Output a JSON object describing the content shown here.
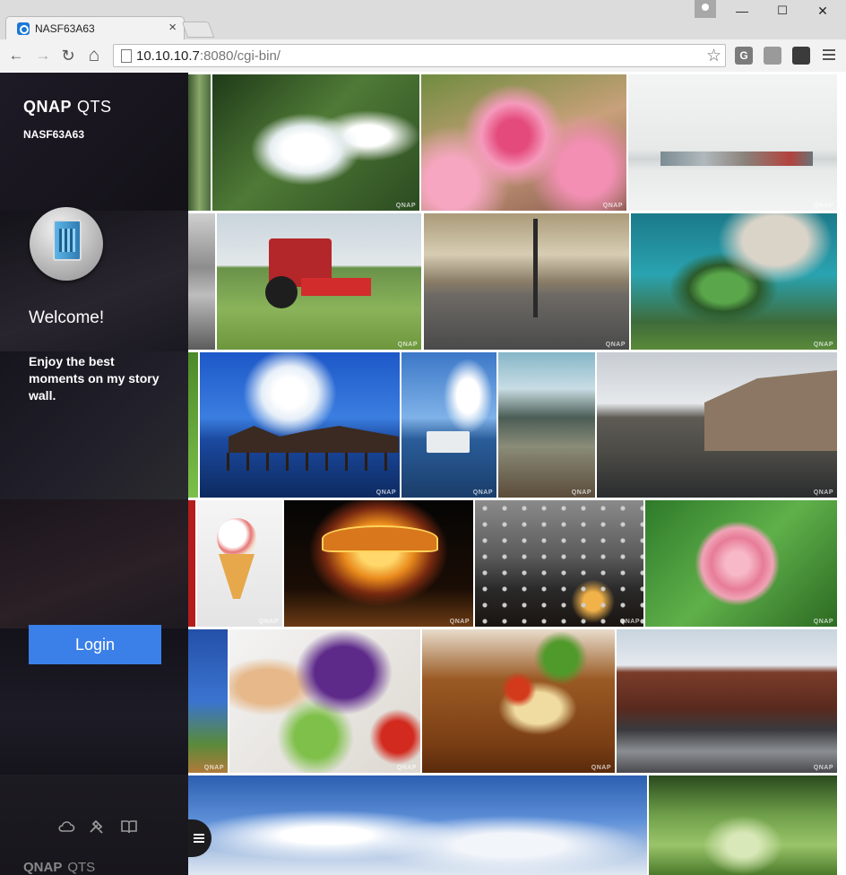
{
  "browser": {
    "tab_title": "NASF63A63",
    "tab_close": "×",
    "url_host": "10.10.10.7",
    "url_rest": ":8080/cgi-bin/",
    "win_minimize": "—",
    "win_maximize": "☐",
    "win_close": "✕",
    "nav_back": "←",
    "nav_forward": "→",
    "nav_reload": "↻",
    "nav_home": "⌂",
    "star": "☆",
    "ext_g": "G"
  },
  "sidebar": {
    "brand_main": "QNAP",
    "brand_sub": "QTS",
    "device_name": "NASF63A63",
    "welcome": "Welcome!",
    "tagline": "Enjoy the best moments on my story wall.",
    "login_label": "Login",
    "footer_brand_main": "QNAP",
    "footer_brand_sub": "QTS",
    "icons": [
      "cloud-icon",
      "tools-icon",
      "book-icon"
    ]
  },
  "wall": {
    "watermark": "QNAP",
    "photos": [
      "white-cyclamen-photo",
      "pink-blossom-photo",
      "fishing-boats-mist-photo",
      "seaside-rocks-photo",
      "tractor-field-photo",
      "street-intersection-photo",
      "heart-stone-weir-photo",
      "green-leaf-strip-photo",
      "overwater-bungalows-photo",
      "harbor-yacht-photo",
      "long-exposure-rocks-photo",
      "canal-warehouses-photo",
      "red-strip-photo",
      "ice-cream-cone-photo",
      "carousel-night-photo",
      "rainy-window-photo",
      "pink-rose-bud-photo",
      "sea-cliff-strip-photo",
      "grilled-eggplant-photo",
      "curry-dish-photo",
      "brick-warehouse-canal-photo",
      "blue-sky-clouds-photo",
      "green-trees-photo"
    ]
  }
}
